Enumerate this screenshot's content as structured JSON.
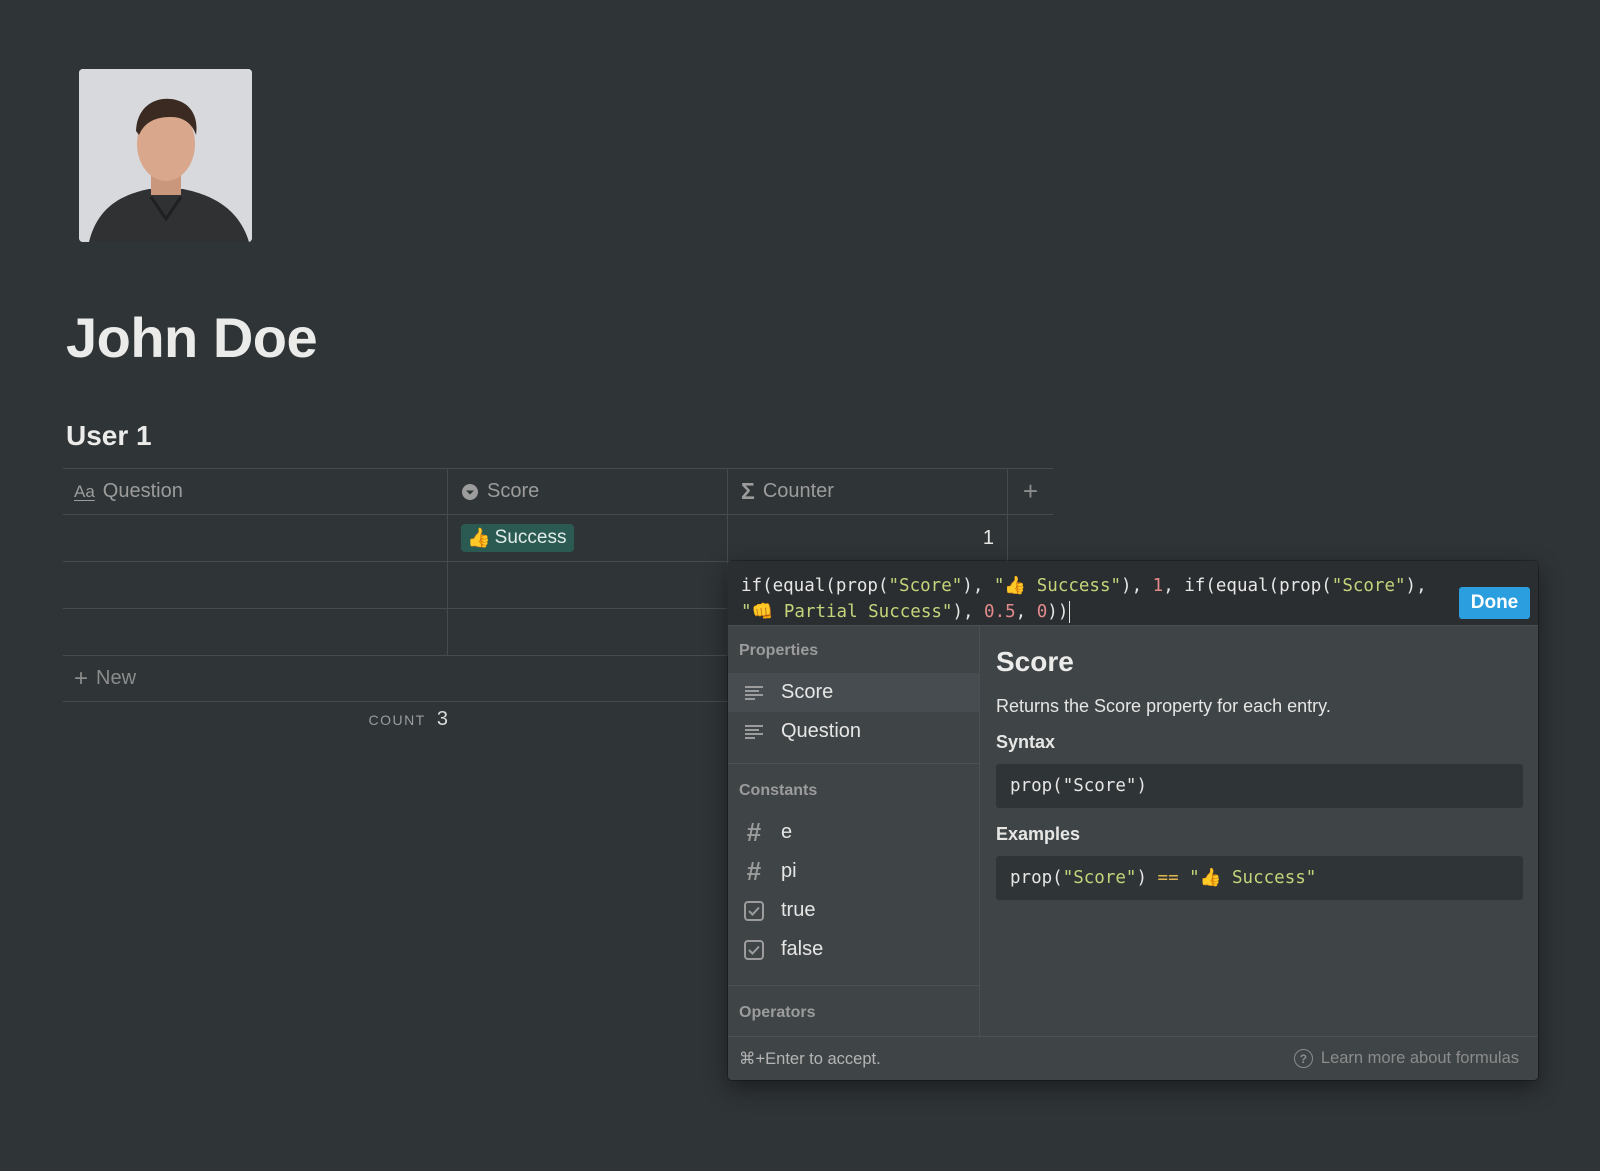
{
  "page": {
    "title": "John Doe",
    "database_title": "User 1"
  },
  "table": {
    "columns": [
      {
        "icon": "text-aa-icon",
        "label": "Question"
      },
      {
        "icon": "select-chevron-icon",
        "label": "Score"
      },
      {
        "icon": "sigma-formula-icon",
        "label": "Counter"
      }
    ],
    "add_column_label": "+",
    "rows": [
      {
        "question": "",
        "score_emoji": "👍",
        "score": "Success",
        "counter": "1"
      },
      {
        "question": "",
        "score_emoji": "",
        "score": "",
        "counter": ""
      },
      {
        "question": "",
        "score_emoji": "",
        "score": "",
        "counter": ""
      }
    ],
    "new_label": "New",
    "count_label": "COUNT",
    "count_value": "3",
    "colors": {
      "success_tag_bg": "#2b5a52"
    }
  },
  "formula": {
    "line1": [
      {
        "t": "if(equal(prop(",
        "k": "plain"
      },
      {
        "t": "\"Score\"",
        "k": "str"
      },
      {
        "t": "), ",
        "k": "plain"
      },
      {
        "t": "\"👍 Success\"",
        "k": "str"
      },
      {
        "t": "), ",
        "k": "plain"
      },
      {
        "t": "1",
        "k": "num"
      },
      {
        "t": ", if(equal(prop(",
        "k": "plain"
      },
      {
        "t": "\"Score\"",
        "k": "str"
      },
      {
        "t": "),",
        "k": "plain"
      }
    ],
    "line2": [
      {
        "t": "\"👊 Partial Success\"",
        "k": "str"
      },
      {
        "t": "), ",
        "k": "plain"
      },
      {
        "t": "0.5",
        "k": "num"
      },
      {
        "t": ", ",
        "k": "plain"
      },
      {
        "t": "0",
        "k": "num"
      },
      {
        "t": "))",
        "k": "plain"
      }
    ],
    "done_label": "Done",
    "colors": {
      "string": "#c5d47a",
      "number": "#e28a8a",
      "done": "#2a9ede"
    }
  },
  "sidebar": {
    "properties_label": "Properties",
    "properties": [
      "Score",
      "Question"
    ],
    "constants_label": "Constants",
    "constants": [
      {
        "label": "e",
        "icon": "hash-icon"
      },
      {
        "label": "pi",
        "icon": "hash-icon"
      },
      {
        "label": "true",
        "icon": "checkbox-icon"
      },
      {
        "label": "false",
        "icon": "checkbox-icon"
      }
    ],
    "operators_label": "Operators"
  },
  "detail": {
    "title": "Score",
    "description": "Returns the Score property for each entry.",
    "syntax_label": "Syntax",
    "syntax": [
      {
        "t": "prop(",
        "k": "plain"
      },
      {
        "t": "\"Score\"",
        "k": "plain"
      },
      {
        "t": ")",
        "k": "plain"
      }
    ],
    "examples_label": "Examples",
    "example": [
      {
        "t": "prop(",
        "k": "plain"
      },
      {
        "t": "\"Score\"",
        "k": "str"
      },
      {
        "t": ") ",
        "k": "plain"
      },
      {
        "t": "==",
        "k": "op"
      },
      {
        "t": " ",
        "k": "plain"
      },
      {
        "t": "\"👍 Success\"",
        "k": "str"
      }
    ]
  },
  "footer": {
    "hint": "⌘+Enter to accept.",
    "help_link": "Learn more about formulas"
  }
}
